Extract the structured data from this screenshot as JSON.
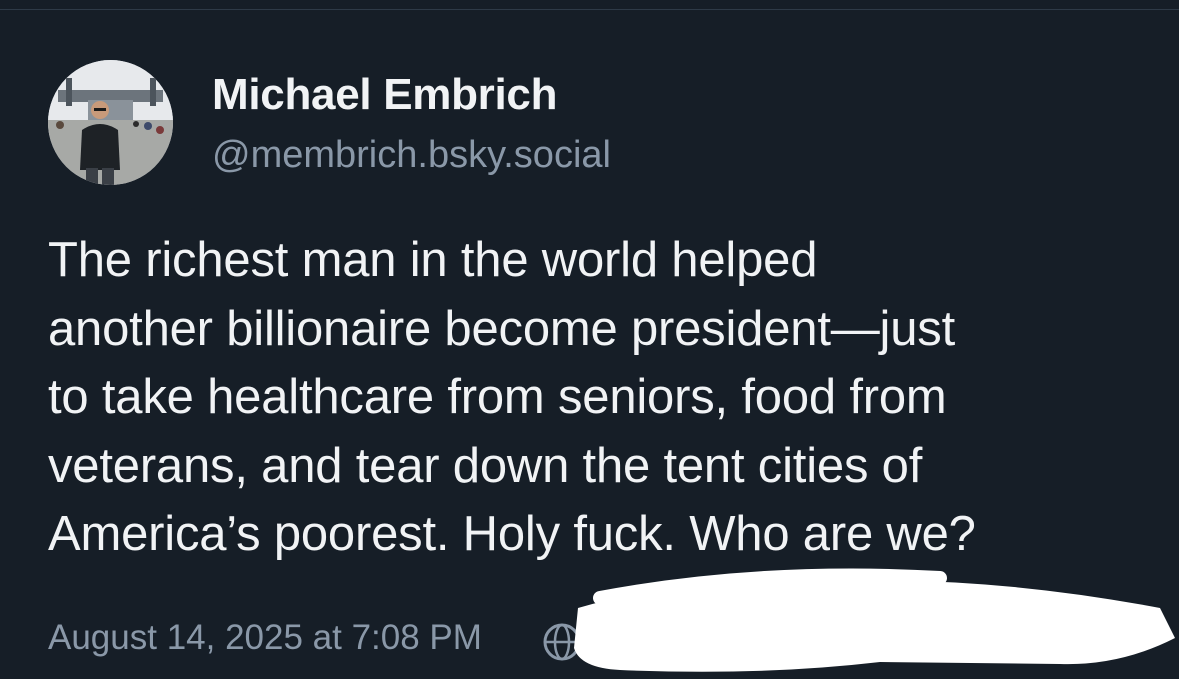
{
  "author": {
    "display_name": "Michael Embrich",
    "handle": "@membrich.bsky.social"
  },
  "post": {
    "lines": [
      "The richest man in the world helped",
      "another billionaire become president—just",
      "to take healthcare from seniors, food from",
      "veterans, and tear down the tent cities of",
      "America’s poorest. Holy fuck. Who are we?"
    ],
    "timestamp": "August 14, 2025 at 7:08 PM",
    "visibility_icon": "globe-icon"
  },
  "colors": {
    "background": "#161e27",
    "primary_text": "#f1f3f5",
    "secondary_text": "#8a98a8",
    "redaction": "#ffffff"
  }
}
